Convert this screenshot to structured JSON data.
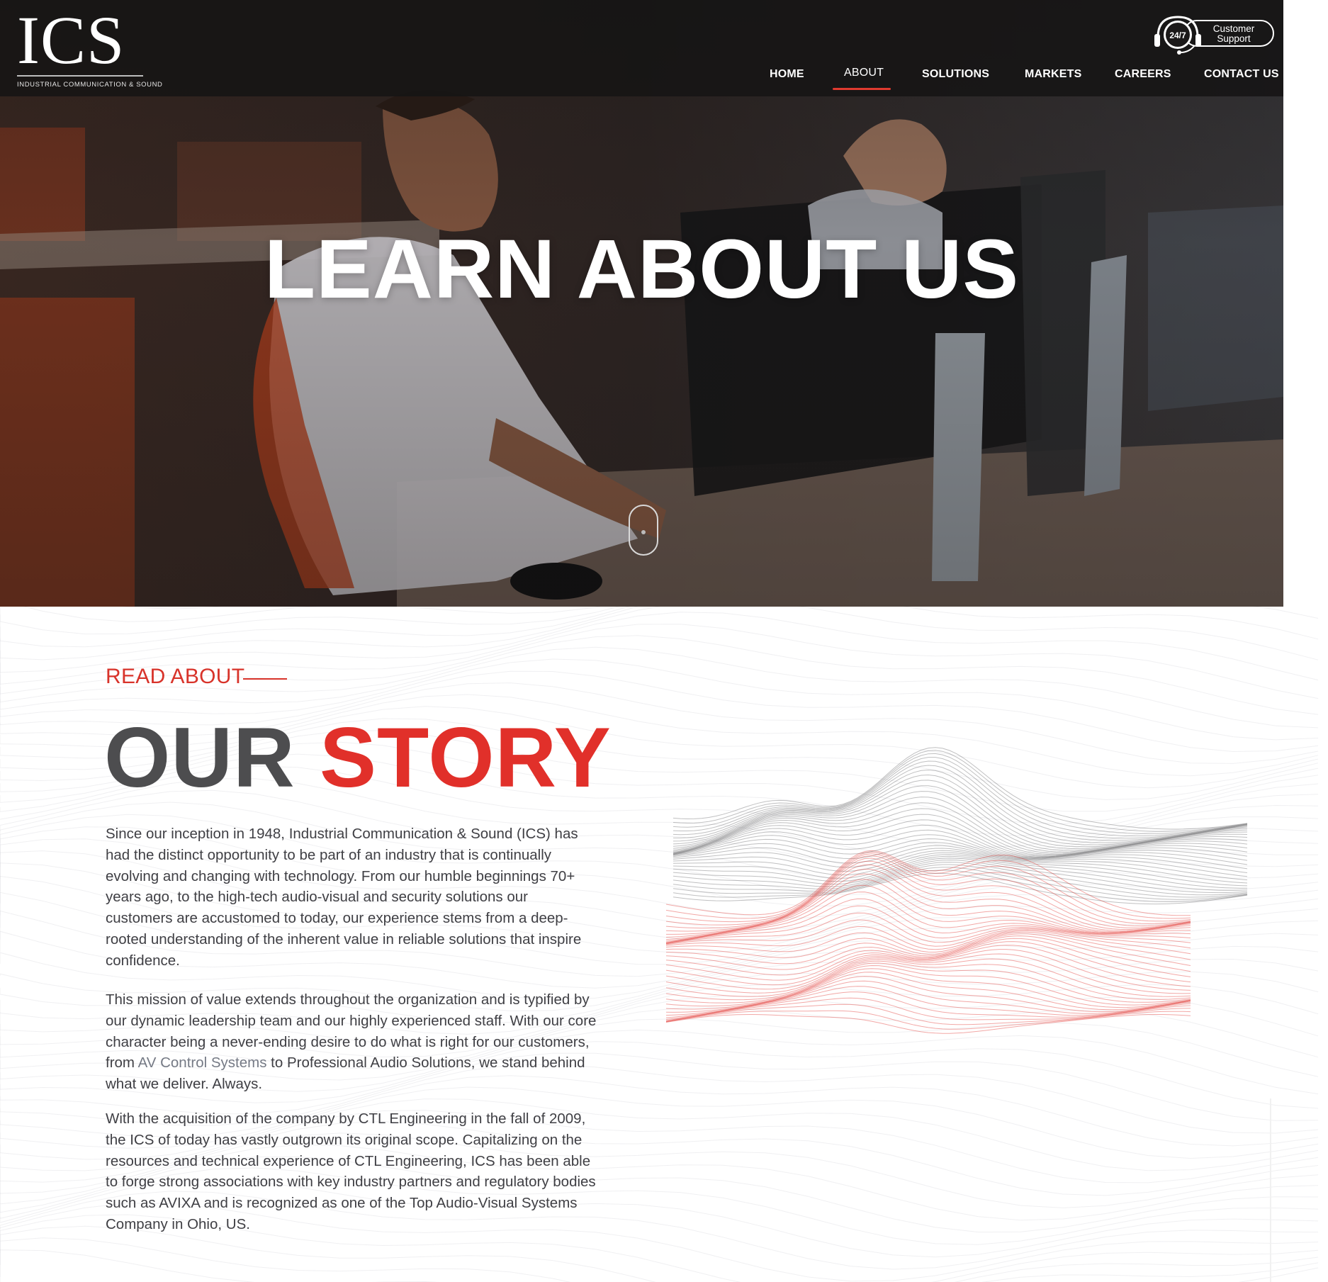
{
  "brand": {
    "logo_text": "ICS",
    "logo_subtitle": "INDUSTRIAL COMMUNICATION & SOUND"
  },
  "support": {
    "badge": "24/7",
    "line1": "Customer",
    "line2": "Support",
    "icon": "headset-icon"
  },
  "nav": {
    "items": [
      {
        "label": "HOME"
      },
      {
        "label": "ABOUT",
        "active": true
      },
      {
        "label": "SOLUTIONS"
      },
      {
        "label": "MARKETS"
      },
      {
        "label": "CAREERS"
      },
      {
        "label": "CONTACT US"
      }
    ]
  },
  "hero": {
    "title": "LEARN ABOUT US",
    "scroll_icon": "scroll-mouse-icon"
  },
  "story": {
    "eyebrow": "READ ABOUT",
    "heading_part1": "OUR",
    "heading_part2": "STORY",
    "p1": "Since our inception in 1948, Industrial Communication & Sound (ICS) has had the distinct opportunity to be part of an industry that is continually evolving and changing with technology. From our humble beginnings 70+ years ago, to the high-tech audio-visual and security solutions our customers are accustomed to today, our experience stems from a deep-rooted understanding of the inherent value in reliable solutions that inspire confidence.",
    "p2_before": "This mission of value extends throughout the organization and is typified by our dynamic leadership team and our highly experienced staff. With our core character being a never-ending desire to do what is right for our customers, from ",
    "p2_link": "AV Control Systems",
    "p2_after": " to Professional Audio Solutions, we stand behind what we deliver. Always.",
    "p3": "With the acquisition of the company by CTL Engineering in the fall of 2009, the ICS of today has vastly outgrown its original scope. Capitalizing on the resources and technical experience of CTL Engineering, ICS has been able to forge strong associations with key industry partners and regulatory bodies such as AVIXA and is recognized as one of the Top Audio-Visual Systems Company in Ohio, US."
  },
  "colors": {
    "accent": "#e1302a",
    "heading_gray": "#4d4d4f",
    "topbar": "#161414",
    "link": "#757a85"
  }
}
